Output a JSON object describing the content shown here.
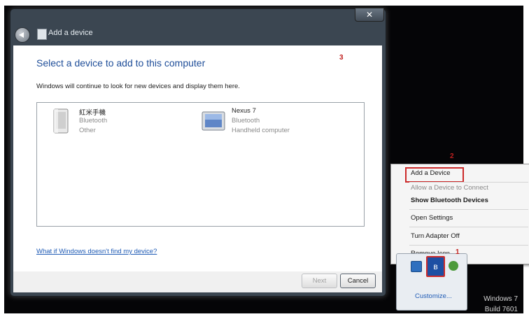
{
  "dialog": {
    "title": "Add a device",
    "close_glyph": "✕",
    "heading": "Select a device to add to this computer",
    "annotation": "3",
    "subtext": "Windows will continue to look for new devices and display them here.",
    "devices": [
      {
        "name": "紅米手機",
        "type": "Bluetooth",
        "category": "Other",
        "icon": "phone-device-icon"
      },
      {
        "name": "Nexus 7",
        "type": "Bluetooth",
        "category": "Handheld computer",
        "icon": "tablet-device-icon"
      }
    ],
    "help_link": "What if Windows doesn't find my device?",
    "next_label": "Next",
    "cancel_label": "Cancel"
  },
  "context_menu": {
    "annotation": "2",
    "items": [
      {
        "label": "Add a Device"
      },
      {
        "label": "Allow a Device to Connect"
      },
      {
        "label": "Show Bluetooth Devices"
      },
      {
        "label": "Open Settings"
      },
      {
        "label": "Turn Adapter Off"
      },
      {
        "label": "Remove Icon"
      }
    ]
  },
  "tray": {
    "annotation": "1",
    "bluetooth_glyph": "ʙ",
    "customize_label": "Customize...",
    "icons": [
      "network-icon",
      "bluetooth-icon",
      "shield-icon"
    ]
  },
  "os_watermark": {
    "line1": "Windows 7",
    "line2": "Build 7601"
  },
  "colors": {
    "annotation": "#cc2a2a",
    "heading": "#1f4e99",
    "link": "#1f5bb5"
  }
}
